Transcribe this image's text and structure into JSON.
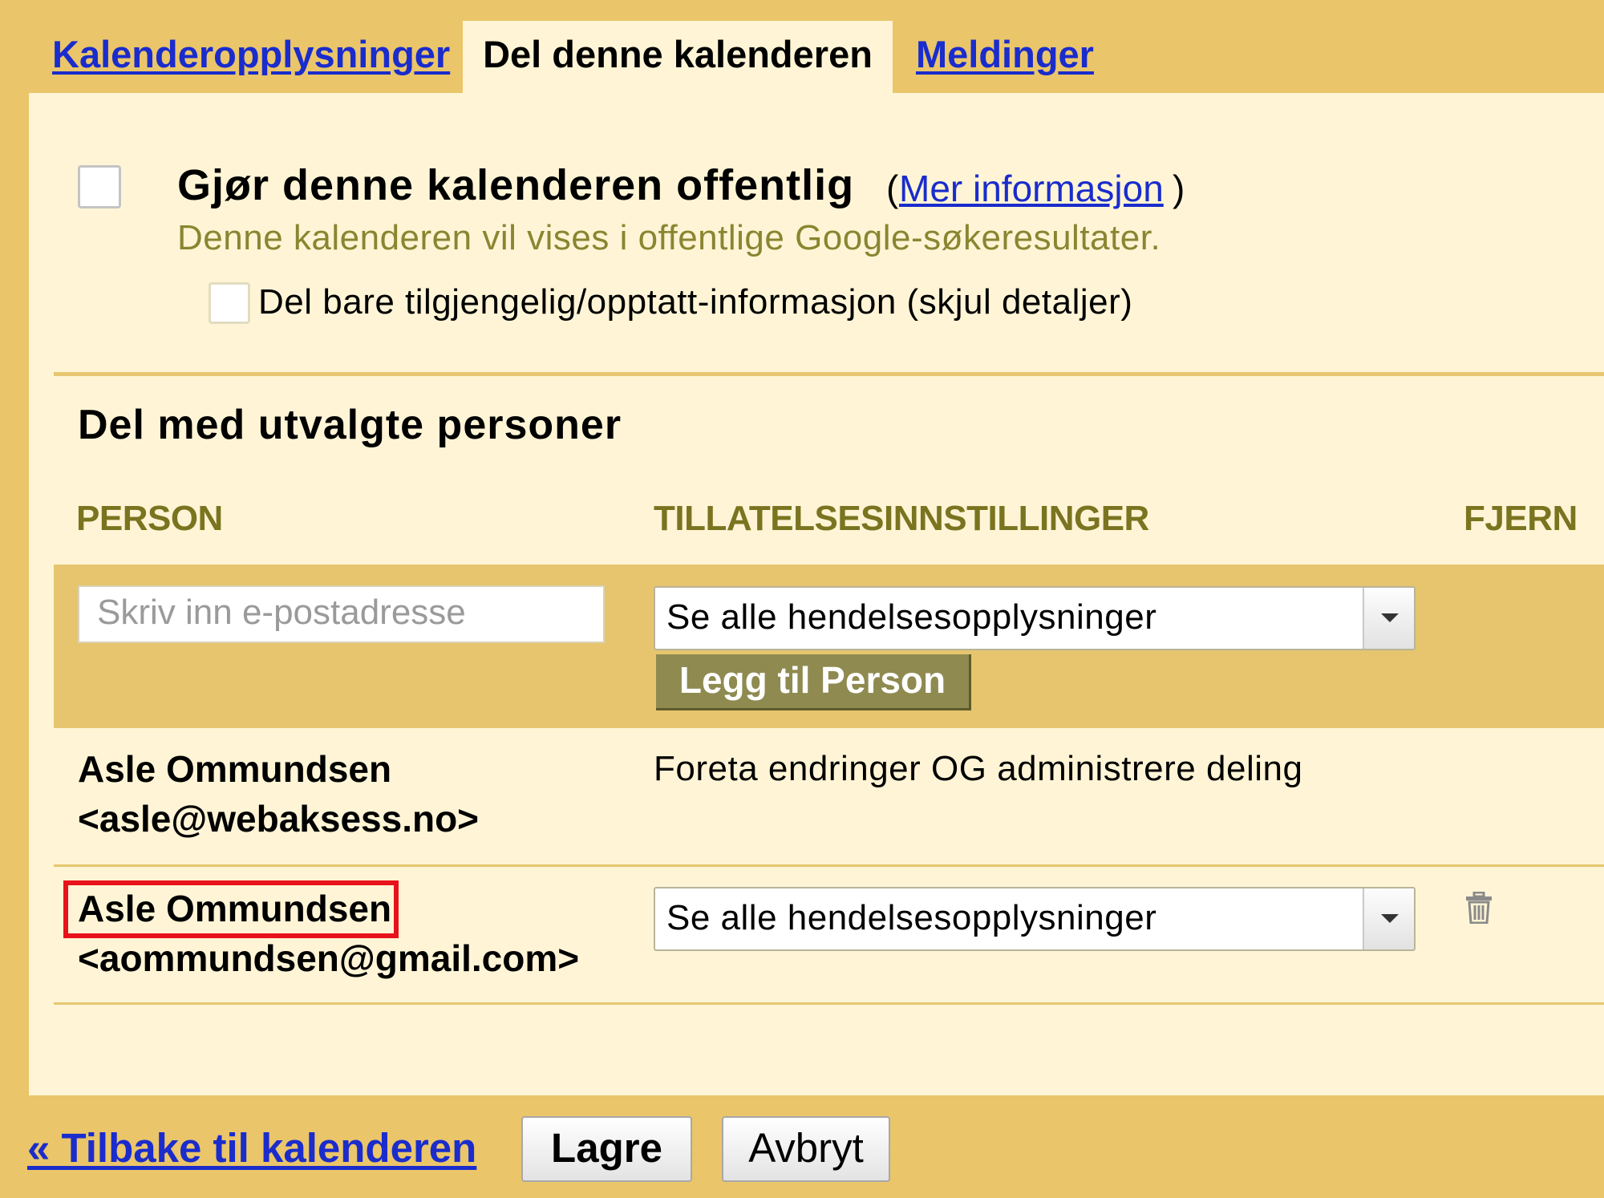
{
  "tabs": {
    "details_label": "Kalenderopplysninger",
    "share_label": "Del denne kalenderen",
    "notifications_label": "Meldinger"
  },
  "public_section": {
    "title": "Gjør denne kalenderen offentlig",
    "more_info_open": "(",
    "more_info_link": "Mer informasjon",
    "more_info_close": ")",
    "description": "Denne kalenderen vil vises i offentlige Google-søkeresultater.",
    "free_busy_label": "Del bare tilgjengelig/opptatt-informasjon (skjul detaljer)"
  },
  "share_section": {
    "title": "Del med utvalgte personer",
    "col_person": "PERSON",
    "col_permissions": "TILLATELSESINNSTILLINGER",
    "col_remove": "FJERN"
  },
  "add_row": {
    "email_placeholder": "Skriv inn e-postadresse",
    "permission_value": "Se alle hendelsesopplysninger",
    "add_button": "Legg til Person"
  },
  "people": [
    {
      "name": "Asle Ommundsen",
      "email": "<asle@webaksess.no>",
      "permission": "Foreta endringer OG administrere deling"
    },
    {
      "name": "Asle Ommundsen",
      "email": "<aommundsen@gmail.com>",
      "permission": "Se alle hendelsesopplysninger"
    }
  ],
  "footer": {
    "back_link": "« Tilbake til kalenderen",
    "save": "Lagre",
    "cancel": "Avbryt"
  },
  "colors": {
    "background": "#eac56a",
    "panel": "#fff5d6",
    "link": "#1a2ccc",
    "highlight": "#e8121a",
    "add_button": "#8f8a50"
  }
}
